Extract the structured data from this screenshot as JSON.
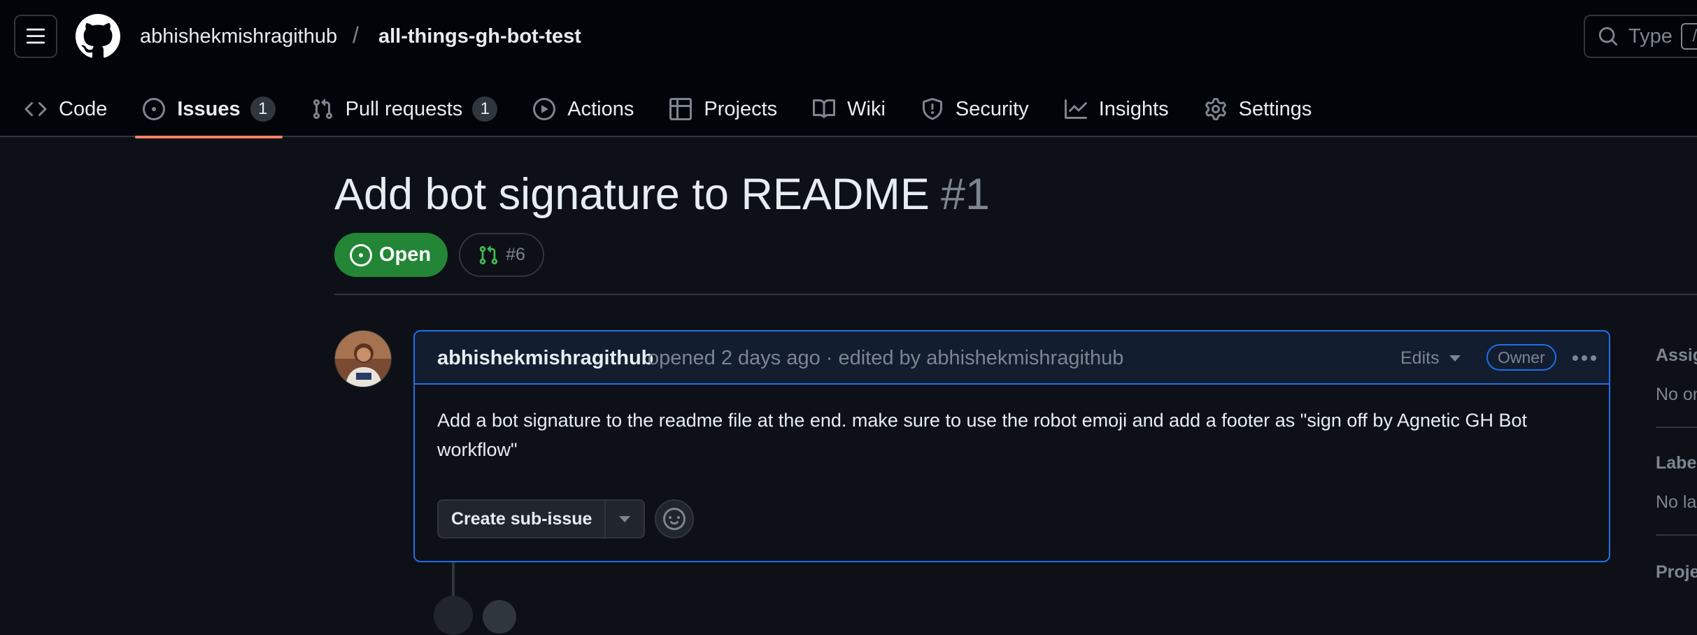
{
  "header": {
    "owner": "abhishekmishragithub",
    "separator": "/",
    "repo": "all-things-gh-bot-test",
    "search_placeholder": "Type",
    "search_shortcut": "/"
  },
  "tabs": [
    {
      "label": "Code",
      "icon": "code-icon"
    },
    {
      "label": "Issues",
      "icon": "issue-opened-icon",
      "count": "1",
      "active": true
    },
    {
      "label": "Pull requests",
      "icon": "git-pull-request-icon",
      "count": "1"
    },
    {
      "label": "Actions",
      "icon": "play-icon"
    },
    {
      "label": "Projects",
      "icon": "table-icon"
    },
    {
      "label": "Wiki",
      "icon": "book-icon"
    },
    {
      "label": "Security",
      "icon": "shield-icon"
    },
    {
      "label": "Insights",
      "icon": "graph-icon"
    },
    {
      "label": "Settings",
      "icon": "gear-icon"
    }
  ],
  "issue": {
    "title": "Add bot signature to README",
    "number": "#1",
    "state": "Open",
    "linked_pr": "#6"
  },
  "comment": {
    "author": "abhishekmishragithub",
    "meta": "opened 2 days ago · edited by abhishekmishragithub",
    "edits_label": "Edits",
    "role_badge": "Owner",
    "body": "Add a bot signature to the readme file at the end. make sure to use the robot emoji and add a footer as \"sign off by Agnetic GH Bot workflow\"",
    "create_sub_issue_label": "Create sub-issue"
  },
  "sidebar": {
    "assignees_heading": "Assig",
    "assignees_value": "No on",
    "labels_heading": "Labe",
    "labels_value": "No la",
    "projects_heading": "Proje"
  },
  "colors": {
    "background": "#0d1117",
    "header_bg": "#010409",
    "border": "#30363d",
    "open_green": "#238636",
    "active_tab_underline": "#f78166",
    "accent_blue": "#1f6feb",
    "muted_text": "#7d8590"
  }
}
